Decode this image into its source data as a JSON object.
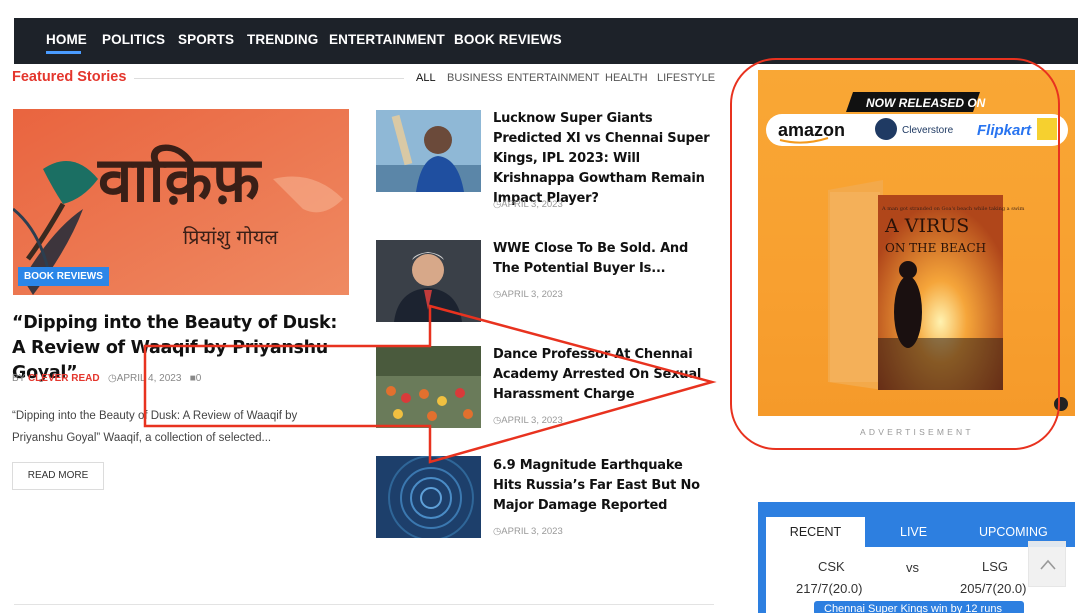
{
  "nav": {
    "items": [
      "HOME",
      "POLITICS",
      "SPORTS",
      "TRENDING",
      "ENTERTAINMENT",
      "BOOK REVIEWS"
    ],
    "active": "HOME"
  },
  "featured": {
    "section_title": "Featured Stories",
    "filters": [
      "ALL",
      "BUSINESS",
      "ENTERTAINMENT",
      "HEALTH",
      "LIFESTYLE"
    ],
    "active_filter": "ALL",
    "main": {
      "image_text_title": "वाक़िफ़",
      "image_text_author": "प्रियांशु गोयल",
      "category": "BOOK REVIEWS",
      "title": "“Dipping into the Beauty of Dusk: A Review of Waaqif by Priyanshu Goyal”",
      "by": "BY",
      "author": "CLEVER READ",
      "date": "APRIL 4, 2023",
      "comments": "0",
      "excerpt": "“Dipping into the Beauty of Dusk: A Review of Waaqif by Priyanshu Goyal” Waaqif, a collection of selected...",
      "read_more": "READ MORE"
    },
    "list": [
      {
        "title": "Lucknow Super Giants Predicted XI vs Chennai Super Kings, IPL 2023: Will Krishnappa Gowtham Remain Impact Player?",
        "date": "APRIL 3, 2023"
      },
      {
        "title": "WWE Close To Be Sold. And The Potential Buyer Is...",
        "date": "APRIL 3, 2023"
      },
      {
        "title": "Dance Professor At Chennai Academy Arrested On Sexual Harassment Charge",
        "date": "APRIL 3, 2023"
      },
      {
        "title": "6.9 Magnitude Earthquake Hits Russia’s Far East But No Major Damage Reported",
        "date": "APRIL 3, 2023"
      }
    ]
  },
  "ad": {
    "banner": "NOW RELEASED ON",
    "stores": [
      "amazon",
      "Cleverstore",
      "Flipkart"
    ],
    "book_title_line1": "A VIRUS",
    "book_title_line2": "ON THE BEACH",
    "book_tagline": "A man got stranded on Goa's beach while taking a swim",
    "label": "ADVERTISEMENT"
  },
  "cricket": {
    "tabs": [
      "RECENT",
      "LIVE",
      "UPCOMING"
    ],
    "active_tab": "RECENT",
    "team1": "CSK",
    "vs": "vs",
    "team2": "LSG",
    "score1": "217/7(20.0)",
    "score2": "205/7(20.0)",
    "result": "Chennai Super Kings win by 12 runs"
  },
  "colors": {
    "nav_bg": "#1d2229",
    "accent_red": "#e4362d",
    "accent_blue": "#2b86e8",
    "ad_orange": "#f9a735",
    "annotation": "#e8321f"
  }
}
